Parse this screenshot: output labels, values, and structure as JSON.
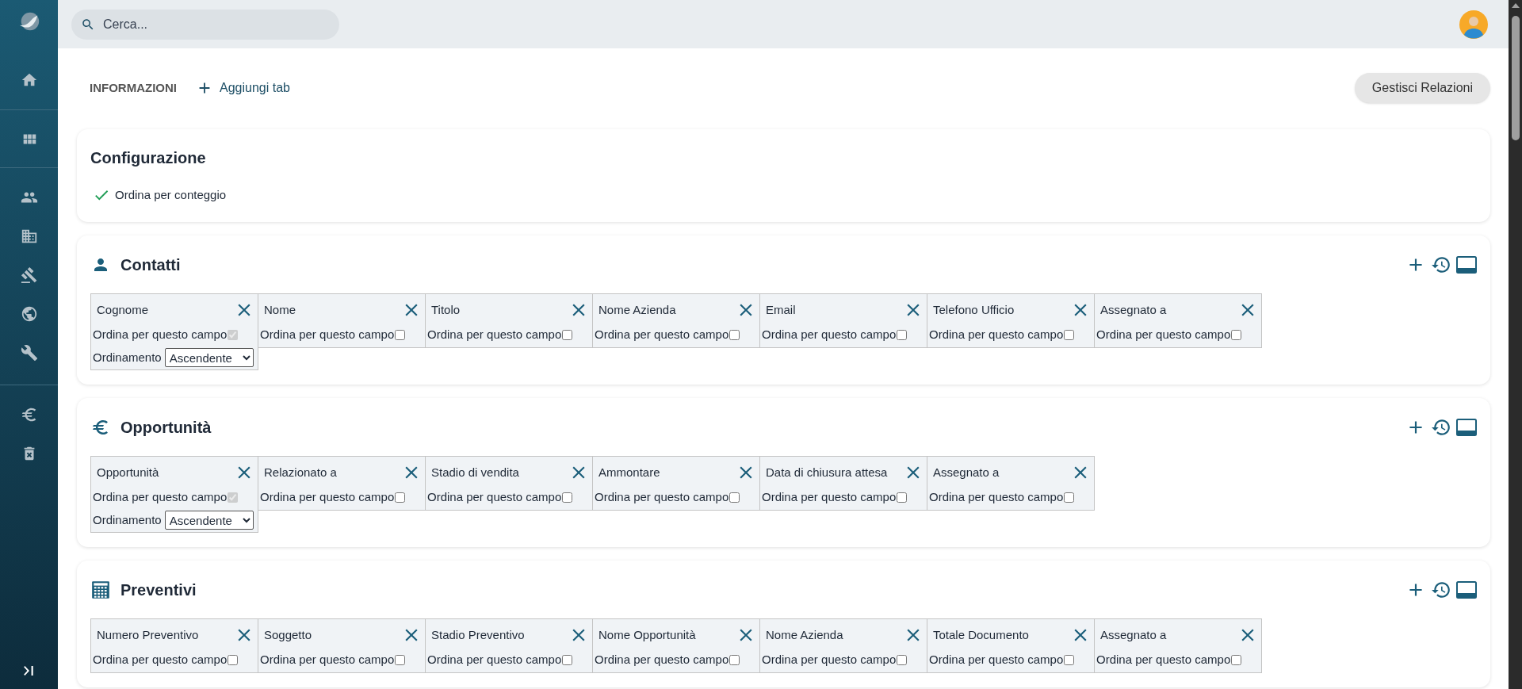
{
  "search": {
    "placeholder": "Cerca..."
  },
  "tabs": [
    {
      "label": "INFORMAZIONI",
      "selected": true
    }
  ],
  "add_tab": "Aggiungi tab",
  "manage_button": "Gestisci Relazioni",
  "configuration": {
    "title": "Configurazione",
    "options": [
      {
        "label": "Ordina per conteggio",
        "checked": true
      }
    ]
  },
  "sections": [
    {
      "title": "Contatti",
      "columns": [
        {
          "label": "Cognome",
          "sort_label": "Ordina per questo campo",
          "sort_checked": true,
          "sort_disabled": true,
          "order_label": "Ordinamento",
          "order_value": "Ascendente"
        },
        {
          "label": "Nome",
          "sort_label": "Ordina per questo campo",
          "sort_checked": false,
          "sort_disabled": false
        },
        {
          "label": "Titolo",
          "sort_label": "Ordina per questo campo",
          "sort_checked": false,
          "sort_disabled": false
        },
        {
          "label": "Nome Azienda",
          "sort_label": "Ordina per questo campo",
          "sort_checked": false,
          "sort_disabled": false
        },
        {
          "label": "Email",
          "sort_label": "Ordina per questo campo",
          "sort_checked": false,
          "sort_disabled": false
        },
        {
          "label": "Telefono Ufficio",
          "sort_label": "Ordina per questo campo",
          "sort_checked": false,
          "sort_disabled": false
        },
        {
          "label": "Assegnato a",
          "sort_label": "Ordina per questo campo",
          "sort_checked": false,
          "sort_disabled": false
        }
      ]
    },
    {
      "title": "Opportunità",
      "columns": [
        {
          "label": "Opportunità",
          "sort_label": "Ordina per questo campo",
          "sort_checked": true,
          "sort_disabled": true,
          "order_label": "Ordinamento",
          "order_value": "Ascendente"
        },
        {
          "label": "Relazionato a",
          "sort_label": "Ordina per questo campo",
          "sort_checked": false,
          "sort_disabled": false
        },
        {
          "label": "Stadio di vendita",
          "sort_label": "Ordina per questo campo",
          "sort_checked": false,
          "sort_disabled": false
        },
        {
          "label": "Ammontare",
          "sort_label": "Ordina per questo campo",
          "sort_checked": false,
          "sort_disabled": false
        },
        {
          "label": "Data di chiusura attesa",
          "sort_label": "Ordina per questo campo",
          "sort_checked": false,
          "sort_disabled": false
        },
        {
          "label": "Assegnato a",
          "sort_label": "Ordina per questo campo",
          "sort_checked": false,
          "sort_disabled": false
        }
      ]
    },
    {
      "title": "Preventivi",
      "columns": [
        {
          "label": "Numero Preventivo",
          "sort_label": "Ordina per questo campo",
          "sort_checked": false,
          "sort_disabled": false
        },
        {
          "label": "Soggetto",
          "sort_label": "Ordina per questo campo",
          "sort_checked": false,
          "sort_disabled": false
        },
        {
          "label": "Stadio Preventivo",
          "sort_label": "Ordina per questo campo",
          "sort_checked": false,
          "sort_disabled": false
        },
        {
          "label": "Nome Opportunità",
          "sort_label": "Ordina per questo campo",
          "sort_checked": false,
          "sort_disabled": false
        },
        {
          "label": "Nome Azienda",
          "sort_label": "Ordina per questo campo",
          "sort_checked": false,
          "sort_disabled": false
        },
        {
          "label": "Totale Documento",
          "sort_label": "Ordina per questo campo",
          "sort_checked": false,
          "sort_disabled": false
        },
        {
          "label": "Assegnato a",
          "sort_label": "Ordina per questo campo",
          "sort_checked": false,
          "sort_disabled": false
        }
      ]
    }
  ]
}
